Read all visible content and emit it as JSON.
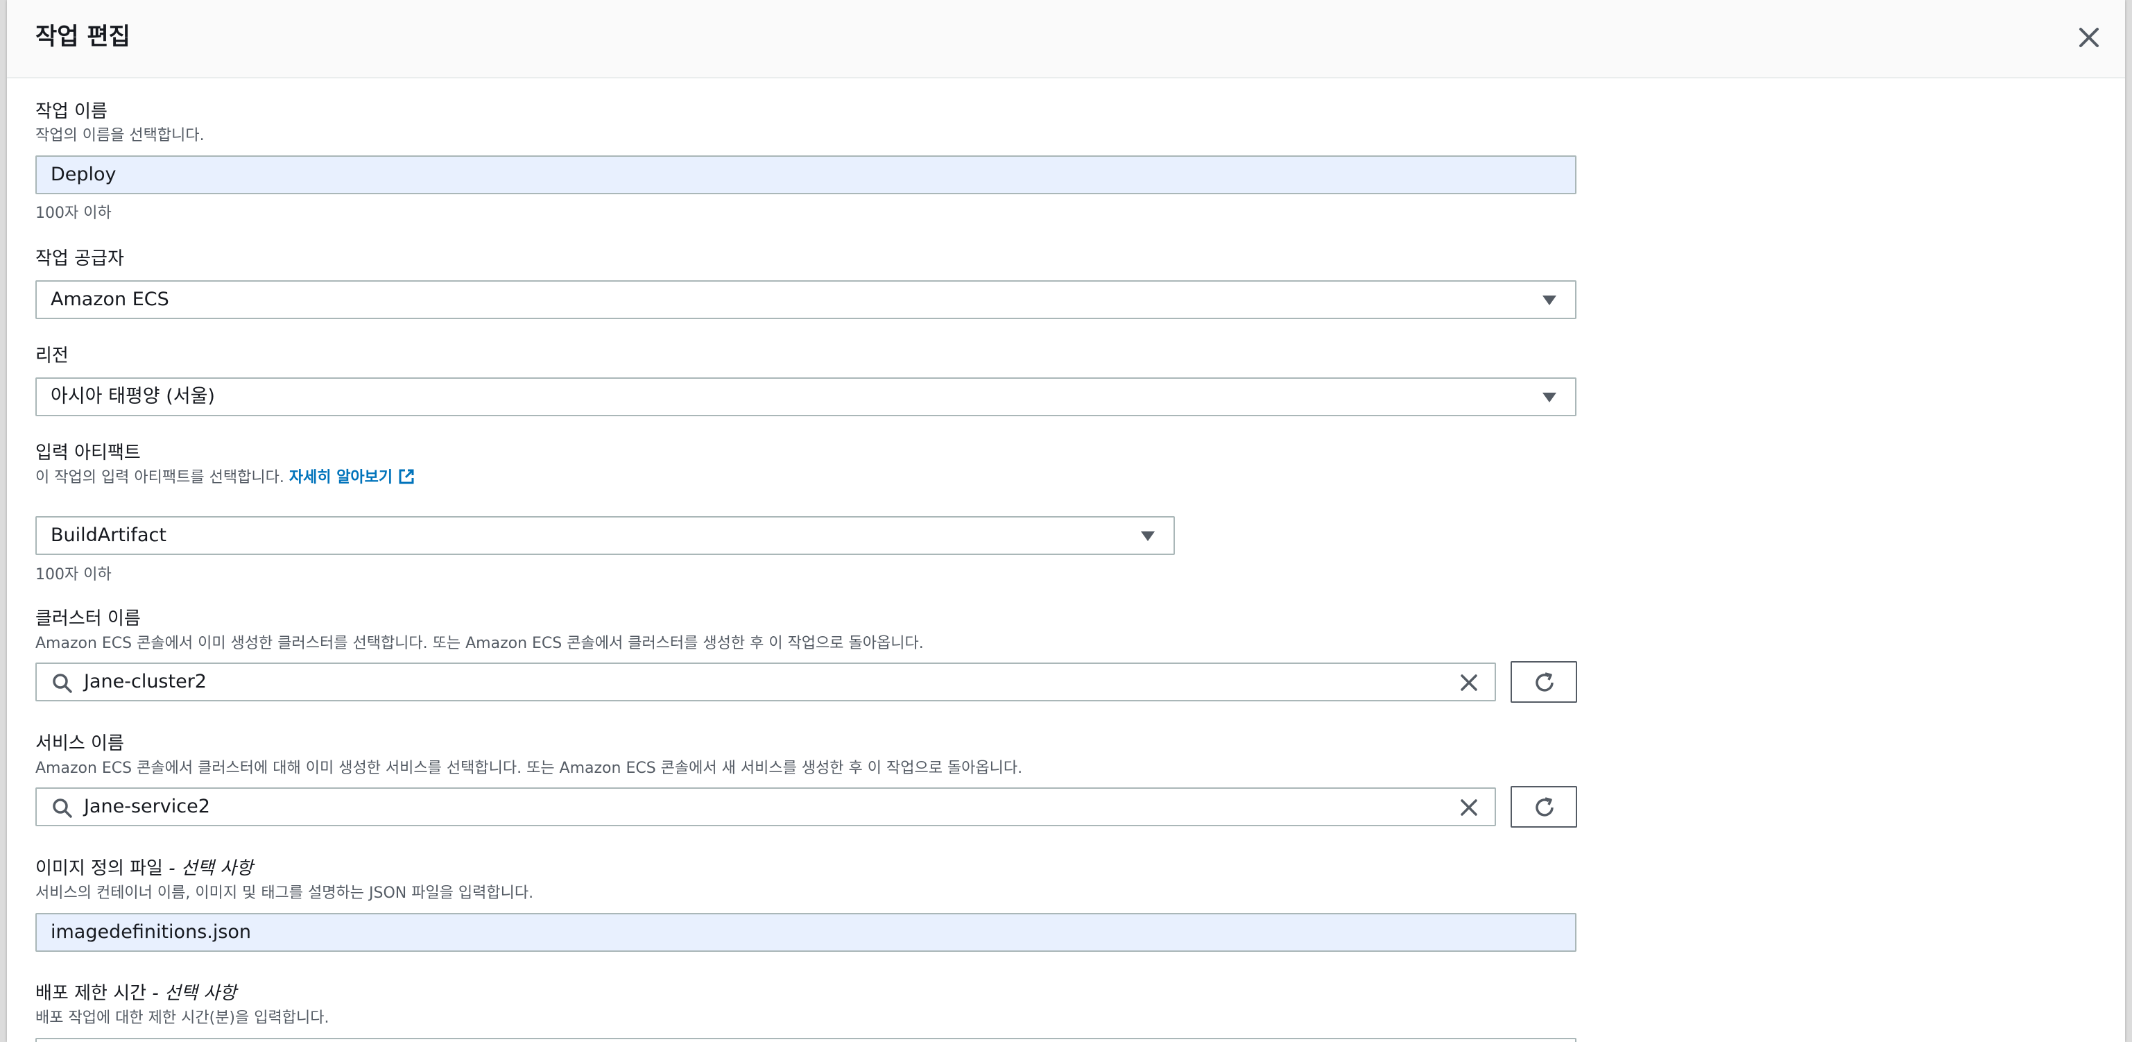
{
  "modal": {
    "title": "작업 편집",
    "close_icon": "close-icon"
  },
  "action_name": {
    "label": "작업 이름",
    "description": "작업의 이름을 선택합니다.",
    "value": "Deploy",
    "constraint": "100자 이하"
  },
  "action_provider": {
    "label": "작업 공급자",
    "value": "Amazon ECS"
  },
  "region": {
    "label": "리전",
    "value": "아시아 태평양 (서울)"
  },
  "input_artifacts": {
    "label": "입력 아티팩트",
    "description": "이 작업의 입력 아티팩트를 선택합니다.",
    "learn_more": "자세히 알아보기",
    "value": "BuildArtifact",
    "constraint": "100자 이하"
  },
  "cluster_name": {
    "label": "클러스터 이름",
    "description": "Amazon ECS 콘솔에서 이미 생성한 클러스터를 선택합니다. 또는 Amazon ECS 콘솔에서 클러스터를 생성한 후 이 작업으로 돌아옵니다.",
    "value": "Jane-cluster2"
  },
  "service_name": {
    "label": "서비스 이름",
    "description": "Amazon ECS 콘솔에서 클러스터에 대해 이미 생성한 서비스를 선택합니다. 또는 Amazon ECS 콘솔에서 새 서비스를 생성한 후 이 작업으로 돌아옵니다.",
    "value": "Jane-service2"
  },
  "image_definitions": {
    "label": "이미지 정의 파일",
    "optional": "- 선택 사항",
    "description": "서비스의 컨테이너 이름, 이미지 및 태그를 설명하는 JSON 파일을 입력합니다.",
    "value": "imagedefinitions.json"
  },
  "deploy_timeout": {
    "label": "배포 제한 시간",
    "optional": "- 선택 사항",
    "description": "배포 작업에 대한 제한 시간(분)을 입력합니다."
  },
  "colors": {
    "link": "#0073bb",
    "filled_input": "#e8f0fe",
    "border": "#aab7b8"
  }
}
